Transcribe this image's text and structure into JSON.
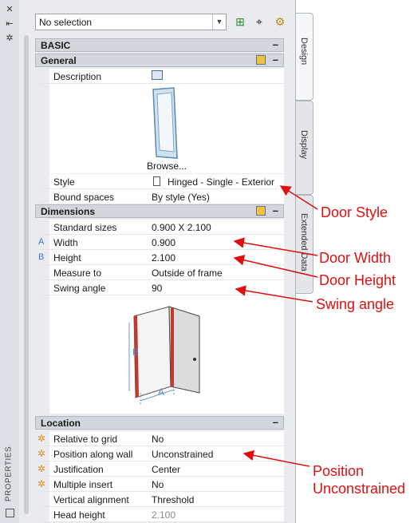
{
  "selector": {
    "value": "No selection"
  },
  "groups": {
    "basic": "BASIC",
    "general": "General",
    "dimensions": "Dimensions",
    "location": "Location",
    "collapse": "–"
  },
  "general": {
    "description_label": "Description",
    "browse_label": "Browse...",
    "style_label": "Style",
    "style_value": "Hinged - Single - Exterior",
    "bound_label": "Bound spaces",
    "bound_value": "By style (Yes)"
  },
  "dimensions": {
    "std_label": "Standard sizes",
    "std_value": "0.900  X  2.100",
    "width_letter": "A",
    "width_label": "Width",
    "width_value": "0.900",
    "height_letter": "B",
    "height_label": "Height",
    "height_value": "2.100",
    "measure_label": "Measure to",
    "measure_value": "Outside of frame",
    "swing_label": "Swing angle",
    "swing_value": "90",
    "diagram_b": "B",
    "diagram_a": "A"
  },
  "location": {
    "rows": [
      {
        "label": "Relative to grid",
        "value": "No"
      },
      {
        "label": "Position along wall",
        "value": "Unconstrained"
      },
      {
        "label": "Justification",
        "value": "Center"
      },
      {
        "label": "Multiple insert",
        "value": "No"
      },
      {
        "label": "Vertical alignment",
        "value": "Threshold"
      },
      {
        "label": "Head height",
        "value": "2.100"
      }
    ]
  },
  "tabs": {
    "design": "Design",
    "display": "Display",
    "extended": "Extended Data"
  },
  "palette_title": "PROPERTIES",
  "annotations": {
    "door_style": "Door Style",
    "door_width": "Door Width",
    "door_height": "Door Height",
    "swing_angle": "Swing angle",
    "position_1": "Position",
    "position_2": "Unconstrained"
  },
  "colors": {
    "annotation": "#e01010",
    "header_bg": "#d2d6dd",
    "letter": "#3a78c8",
    "star": "#e08a20"
  }
}
